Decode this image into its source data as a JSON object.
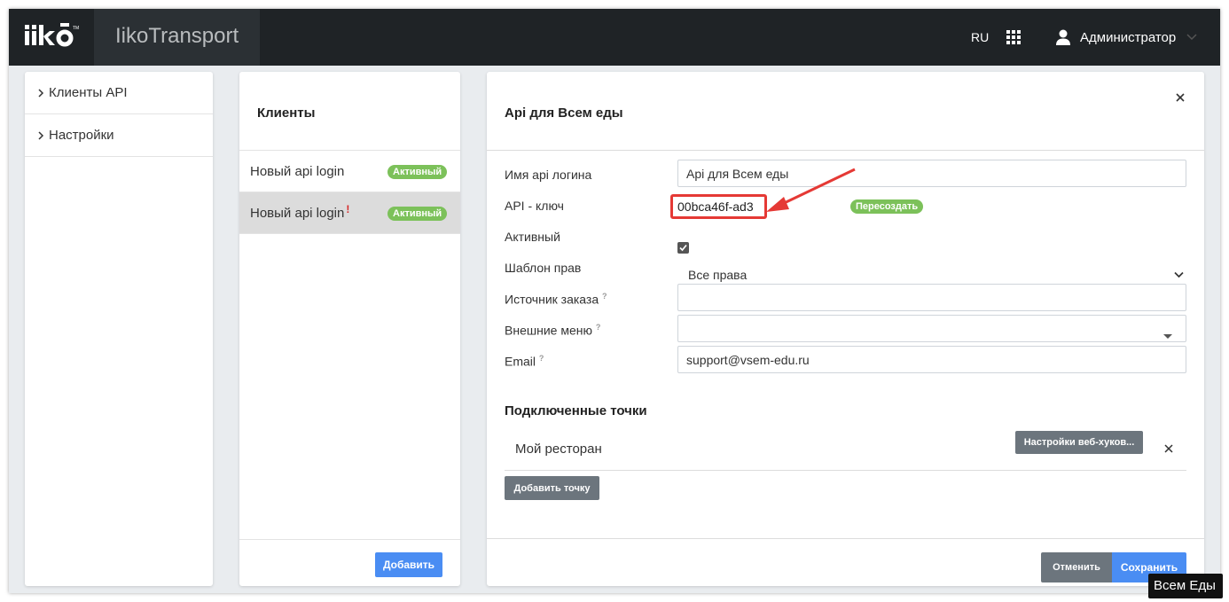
{
  "header": {
    "app_name": "IikoTransport",
    "lang": "RU",
    "user_name": "Администратор"
  },
  "sidebar": {
    "items": [
      {
        "label": "Клиенты API"
      },
      {
        "label": "Настройки"
      }
    ]
  },
  "clients": {
    "title": "Клиенты",
    "rows": [
      {
        "name": "Новый api login",
        "badge": "Активный",
        "warning": ""
      },
      {
        "name": "Новый api login",
        "badge": "Активный",
        "warning": "!"
      }
    ],
    "add_label": "Добавить"
  },
  "detail": {
    "title": "Api для Всем еды",
    "labels": {
      "name": "Имя api логина",
      "api_key": "API - ключ",
      "active": "Активный",
      "rights": "Шаблон прав",
      "source": "Источник заказа",
      "menus": "Внешние меню",
      "email": "Email",
      "help_mark": "?"
    },
    "values": {
      "name": "Api для Всем еды",
      "api_key": "00bca46f-ad3",
      "rights": "Все права",
      "source": "",
      "menus": "",
      "email": "support@vsem-edu.ru"
    },
    "active_checked": true,
    "regenerate_label": "Пересоздать",
    "points_title": "Подключенные точки",
    "point_name": "Мой ресторан",
    "webhook_label": "Настройки веб-хуков...",
    "add_point_label": "Добавить точку",
    "cancel_label": "Отменить",
    "save_label": "Сохранить"
  },
  "watermark": "Всем Еды",
  "colors": {
    "topbar": "#1f2326",
    "badge_green": "#7cc15a",
    "primary_blue": "#4a8df3",
    "secondary_gray": "#6c757d",
    "highlight_red": "#e53935"
  }
}
